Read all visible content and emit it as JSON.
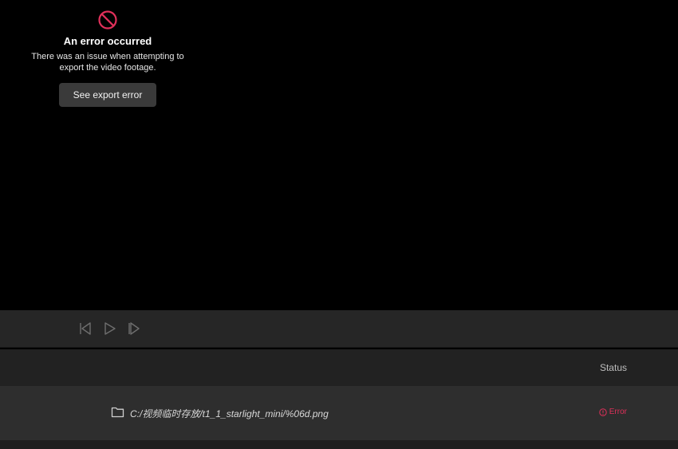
{
  "preview": {
    "error": {
      "icon": "prohibited-icon",
      "title": "An error occurred",
      "message": "There was an issue when attempting to export the video footage.",
      "button_label": "See export error"
    }
  },
  "playback_controls": [
    {
      "icon": "step-back-icon"
    },
    {
      "icon": "play-icon"
    },
    {
      "icon": "step-forward-icon"
    }
  ],
  "table": {
    "columns": {
      "status": "Status"
    },
    "rows": [
      {
        "icon": "folder-icon",
        "path": "C:/视频临时存放/t1_1_starlight_mini/%06d.png",
        "status": "Error",
        "status_icon": "error-circle-icon"
      }
    ]
  },
  "colors": {
    "error": "#e0305a",
    "button": "#3a3a3a",
    "panel": "#262626"
  }
}
